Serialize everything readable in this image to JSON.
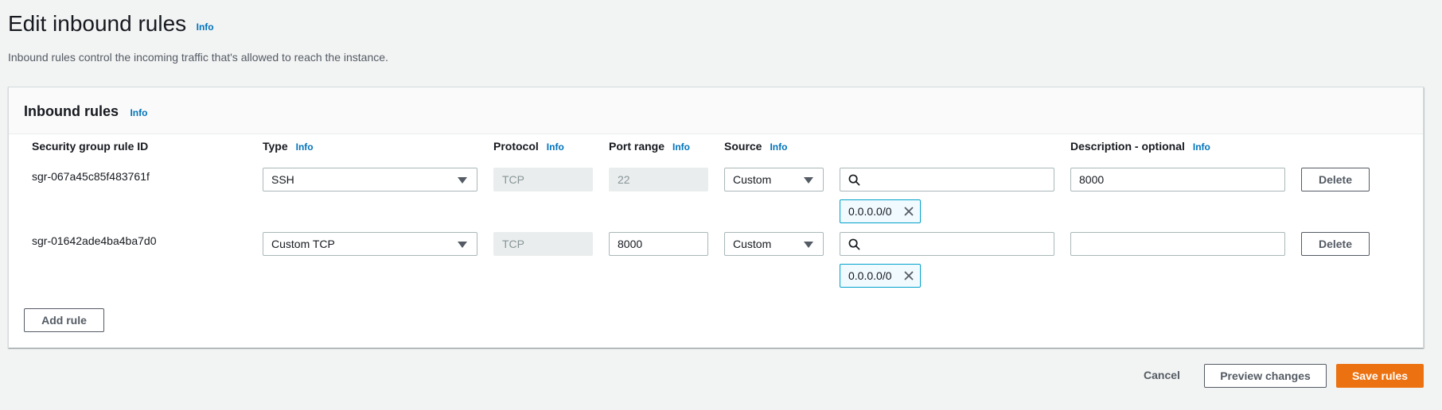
{
  "header": {
    "title": "Edit inbound rules",
    "info": "Info",
    "description": "Inbound rules control the incoming traffic that's allowed to reach the instance."
  },
  "panel": {
    "title": "Inbound rules",
    "info": "Info",
    "columns": {
      "rule_id": "Security group rule ID",
      "type": "Type",
      "type_info": "Info",
      "protocol": "Protocol",
      "protocol_info": "Info",
      "port_range": "Port range",
      "port_range_info": "Info",
      "source": "Source",
      "source_info": "Info",
      "description": "Description - optional",
      "description_info": "Info"
    },
    "rules": [
      {
        "rule_id": "sgr-067a45c85f483761f",
        "type": "SSH",
        "protocol": "TCP",
        "port_range": "22",
        "source": "Custom",
        "search_value": "",
        "cidr_token": "0.0.0.0/0",
        "description": "8000",
        "delete_label": "Delete"
      },
      {
        "rule_id": "sgr-01642ade4ba4ba7d0",
        "type": "Custom TCP",
        "protocol": "TCP",
        "port_range": "8000",
        "source": "Custom",
        "search_value": "",
        "cidr_token": "0.0.0.0/0",
        "description": "",
        "delete_label": "Delete"
      }
    ],
    "add_rule_label": "Add rule"
  },
  "footer": {
    "cancel_label": "Cancel",
    "preview_label": "Preview changes",
    "save_label": "Save rules"
  },
  "colors": {
    "primary": "#ec7211",
    "link": "#0073bb",
    "token_border": "#00a1c9"
  },
  "icons": [
    "search-icon",
    "close-icon",
    "caret-down-icon"
  ]
}
